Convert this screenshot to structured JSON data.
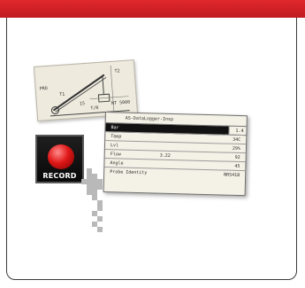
{
  "header": {
    "color": "#d8232a"
  },
  "sketch": {
    "labels": [
      "PRO",
      "T1",
      "T2",
      "15",
      "NT 5000",
      "T/R"
    ]
  },
  "record_button": {
    "label": "RECORD",
    "light_color": "#e01818"
  },
  "dialog": {
    "title": "AS-DataLogger-Insp",
    "rows": [
      {
        "label": "Bar",
        "mid": "",
        "value": "1.4",
        "selected": true
      },
      {
        "label": "Temp",
        "mid": "",
        "value": "34C",
        "selected": false
      },
      {
        "label": "Lvl",
        "mid": "",
        "value": "29%",
        "selected": false
      },
      {
        "label": "Flow",
        "mid": "3.22",
        "value": "92",
        "selected": false
      },
      {
        "label": "Angle",
        "mid": "",
        "value": "45",
        "selected": false
      },
      {
        "label": "Probe Identity",
        "mid": "",
        "value": "NR5418",
        "selected": false
      }
    ]
  },
  "icons": {
    "cursor": "hand-pointer-icon",
    "sketch": "crane-sketch-icon"
  }
}
